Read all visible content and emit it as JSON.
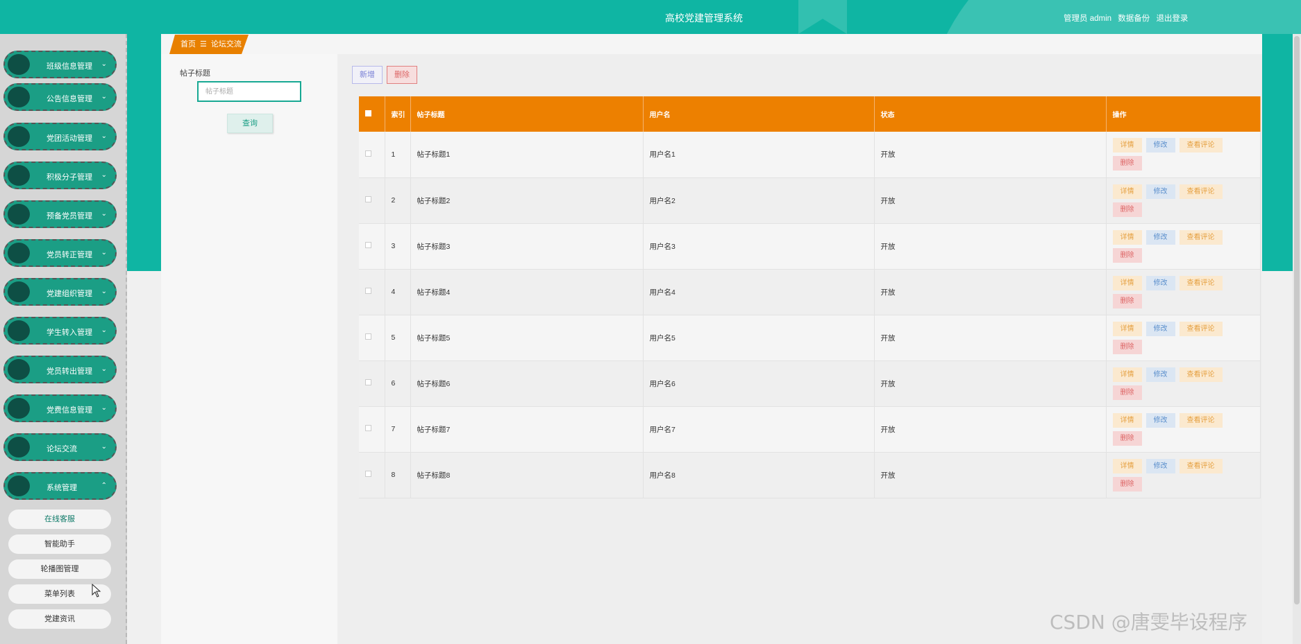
{
  "header": {
    "title": "高校党建管理系统",
    "role_user": "管理员 admin",
    "backup": "数据备份",
    "logout": "退出登录"
  },
  "sidebar": {
    "items": [
      {
        "label": "班级信息管理",
        "chevron": "⌄"
      },
      {
        "label": "公告信息管理",
        "chevron": "⌄"
      },
      {
        "label": "党团活动管理",
        "chevron": "⌄"
      },
      {
        "label": "积极分子管理",
        "chevron": "⌄"
      },
      {
        "label": "预备党员管理",
        "chevron": "⌄"
      },
      {
        "label": "党员转正管理",
        "chevron": "⌄"
      },
      {
        "label": "党建组织管理",
        "chevron": "⌄"
      },
      {
        "label": "学生转入管理",
        "chevron": "⌄"
      },
      {
        "label": "党员转出管理",
        "chevron": "⌄"
      },
      {
        "label": "党费信息管理",
        "chevron": "⌄"
      },
      {
        "label": "论坛交流",
        "chevron": "⌄"
      },
      {
        "label": "系统管理",
        "chevron": "⌃"
      }
    ],
    "sub_items": [
      {
        "label": "在线客服"
      },
      {
        "label": "智能助手"
      },
      {
        "label": "轮播图管理"
      },
      {
        "label": "菜单列表"
      },
      {
        "label": "党建资讯"
      }
    ]
  },
  "breadcrumb": {
    "home": "首页",
    "sep": "☰",
    "current": "论坛交流"
  },
  "search": {
    "label": "帖子标题",
    "placeholder": "帖子标题",
    "query_label": "查询"
  },
  "toolbar": {
    "add_label": "新增",
    "delete_label": "删除"
  },
  "table": {
    "headers": {
      "index": "索引",
      "title": "帖子标题",
      "user": "用户名",
      "status": "状态",
      "ops": "操作"
    },
    "ops": {
      "detail": "详情",
      "edit": "修改",
      "view": "查看评论",
      "delete": "删除"
    },
    "rows": [
      {
        "index": "1",
        "title": "帖子标题1",
        "user": "用户名1",
        "status": "开放"
      },
      {
        "index": "2",
        "title": "帖子标题2",
        "user": "用户名2",
        "status": "开放"
      },
      {
        "index": "3",
        "title": "帖子标题3",
        "user": "用户名3",
        "status": "开放"
      },
      {
        "index": "4",
        "title": "帖子标题4",
        "user": "用户名4",
        "status": "开放"
      },
      {
        "index": "5",
        "title": "帖子标题5",
        "user": "用户名5",
        "status": "开放"
      },
      {
        "index": "6",
        "title": "帖子标题6",
        "user": "用户名6",
        "status": "开放"
      },
      {
        "index": "7",
        "title": "帖子标题7",
        "user": "用户名7",
        "status": "开放"
      },
      {
        "index": "8",
        "title": "帖子标题8",
        "user": "用户名8",
        "status": "开放"
      }
    ]
  },
  "watermark": "CSDN @唐雯毕设程序",
  "colors": {
    "brand": "#0fb5a3",
    "menu": "#1b9e85",
    "table_header": "#ed8000"
  }
}
